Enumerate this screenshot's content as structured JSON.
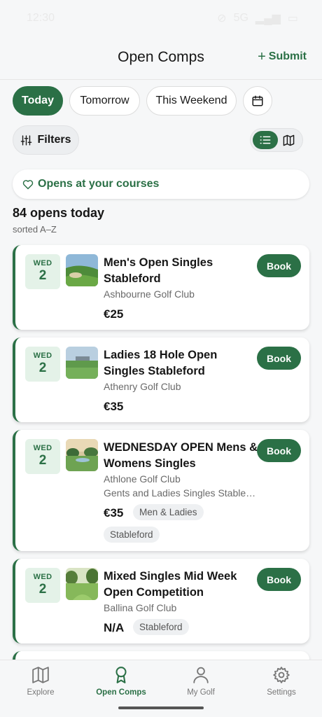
{
  "status_bar": {
    "time": "12:30",
    "network": "5G"
  },
  "header": {
    "title": "Open Comps",
    "submit_label": "Submit"
  },
  "date_chips": [
    {
      "label": "Today",
      "active": true
    },
    {
      "label": "Tomorrow",
      "active": false
    },
    {
      "label": "This Weekend",
      "active": false
    }
  ],
  "calendar_icon": "calendar-icon",
  "filters_label": "Filters",
  "view_toggle": {
    "selected": "list",
    "options": [
      "list-icon",
      "map-icon"
    ]
  },
  "opens_banner": "Opens at your courses",
  "summary": {
    "title": "84 opens today",
    "sort": "sorted A–Z"
  },
  "competitions": [
    {
      "dow": "WED",
      "day": "2",
      "title_lines": [
        "Men's Open Singles",
        "Stableford"
      ],
      "club": "Ashbourne Golf Club",
      "description": "",
      "price": "€25",
      "tags": [],
      "book": "Book"
    },
    {
      "dow": "WED",
      "day": "2",
      "title_lines": [
        "Ladies 18 Hole Open",
        "Singles Stableford"
      ],
      "club": "Athenry Golf Club",
      "description": "",
      "price": "€35",
      "tags": [],
      "book": "Book"
    },
    {
      "dow": "WED",
      "day": "2",
      "title_lines": [
        "WEDNESDAY OPEN Mens &",
        "Womens Singles"
      ],
      "club": "Athlone Golf Club",
      "description": "Gents and Ladies Singles Stablef…",
      "price": "€35",
      "tags": [
        "Men & Ladies",
        "Stableford"
      ],
      "book": "Book"
    },
    {
      "dow": "WED",
      "day": "2",
      "title_lines": [
        "Mixed Singles Mid Week",
        "Open Competition"
      ],
      "club": "Ballina Golf Club",
      "description": "",
      "price": "N/A",
      "tags": [
        "Stableford"
      ],
      "book": "Book"
    }
  ],
  "tabs": [
    {
      "label": "Explore",
      "icon": "map-icon",
      "active": false
    },
    {
      "label": "Open Comps",
      "icon": "award-icon",
      "active": true
    },
    {
      "label": "My Golf",
      "icon": "person-icon",
      "active": false
    },
    {
      "label": "Settings",
      "icon": "gear-icon",
      "active": false
    }
  ],
  "colors": {
    "accent": "#2b7046",
    "accent_light": "#e4f2e8",
    "background": "#f6f7f8"
  }
}
